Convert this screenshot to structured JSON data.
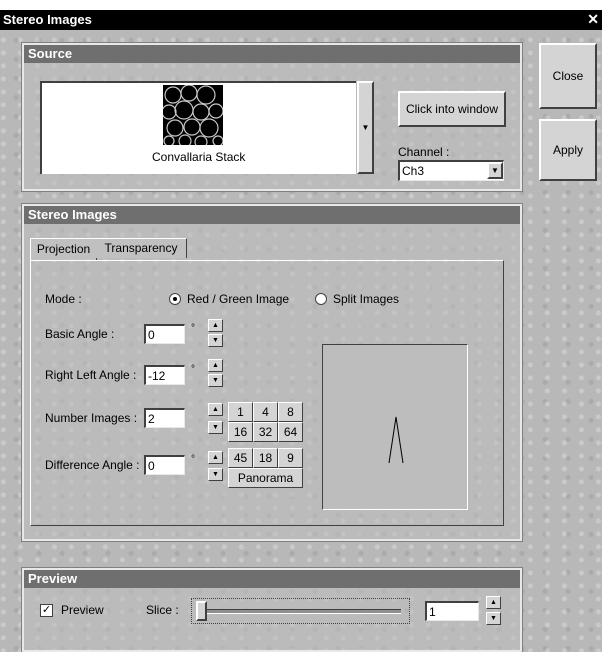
{
  "window": {
    "title": "Stereo Images",
    "close_glyph": "✕"
  },
  "side_buttons": {
    "close": "Close",
    "apply": "Apply"
  },
  "source": {
    "header": "Source",
    "image_label": "Convallaria Stack",
    "click_button": "Click into window",
    "channel_label": "Channel :",
    "channel_value": "Ch3"
  },
  "stereo": {
    "header": "Stereo Images",
    "tabs": [
      "Projection",
      "Transparency"
    ],
    "active_tab": "Projection",
    "mode_label": "Mode :",
    "mode_options": [
      "Red / Green  Image",
      "Split Images"
    ],
    "mode_selected": "Red / Green  Image",
    "basic_angle_label": "Basic Angle :",
    "basic_angle_value": "0",
    "right_left_label": "Right Left Angle :",
    "right_left_value": "-12",
    "number_images_label": "Number Images :",
    "number_images_value": "2",
    "difference_label": "Difference Angle :",
    "difference_value": "0",
    "degree_symbol": "°",
    "number_buttons": [
      "1",
      "4",
      "8",
      "16",
      "32",
      "64"
    ],
    "difference_buttons": [
      "45",
      "18",
      "9"
    ],
    "panorama_label": "Panorama"
  },
  "preview": {
    "header": "Preview",
    "checkbox_label": "Preview",
    "checked": true,
    "slice_label": "Slice :",
    "slice_value": "1",
    "slider_fraction": 0.0
  }
}
